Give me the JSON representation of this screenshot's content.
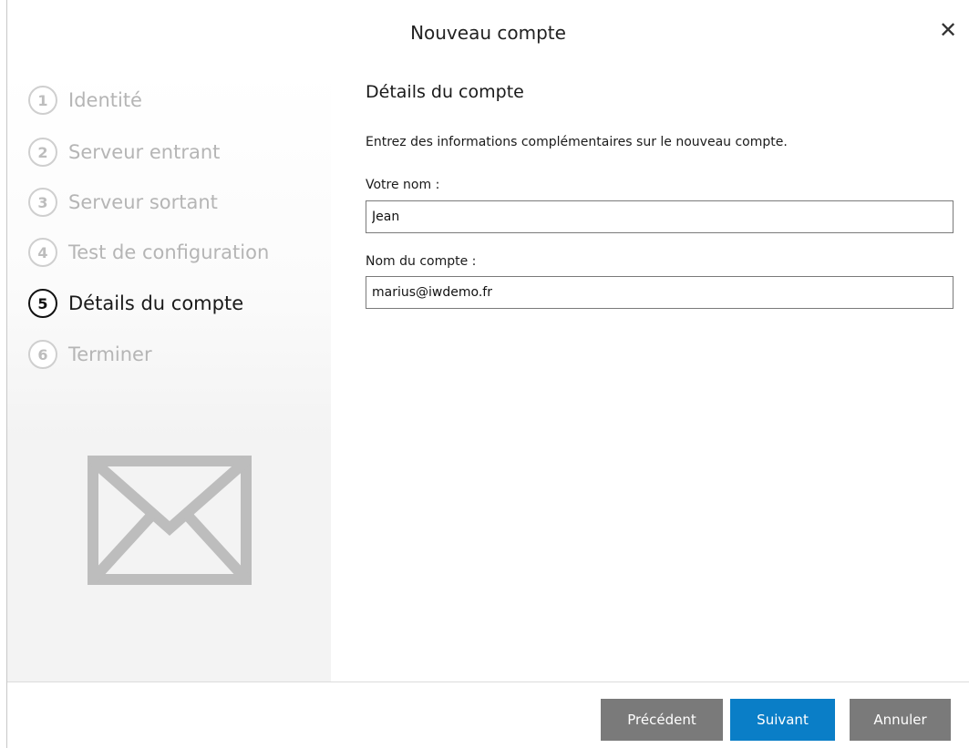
{
  "dialog": {
    "title": "Nouveau compte",
    "close_glyph": "✕"
  },
  "steps": [
    {
      "number": "1",
      "label": "Identité",
      "state": "inactive"
    },
    {
      "number": "2",
      "label": "Serveur entrant",
      "state": "inactive"
    },
    {
      "number": "3",
      "label": "Serveur sortant",
      "state": "inactive"
    },
    {
      "number": "4",
      "label": "Test de configuration",
      "state": "inactive"
    },
    {
      "number": "5",
      "label": "Détails du compte",
      "state": "active"
    },
    {
      "number": "6",
      "label": "Terminer",
      "state": "inactive"
    }
  ],
  "sidebar_illustration": "envelope-icon",
  "main": {
    "section_title": "Détails du compte",
    "intro": "Entrez des informations complémentaires sur le nouveau compte.",
    "your_name": {
      "label": "Votre nom :",
      "value": "Jean"
    },
    "account_name": {
      "label": "Nom du compte :",
      "value": "marius@iwdemo.fr"
    }
  },
  "footer": {
    "previous_label": "Précédent",
    "next_label": "Suivant",
    "cancel_label": "Annuler"
  },
  "colors": {
    "primary_button": "#0a7ec7",
    "secondary_button": "#7a7a7a",
    "inactive_step": "#b5b5b5",
    "active_step": "#111111"
  }
}
